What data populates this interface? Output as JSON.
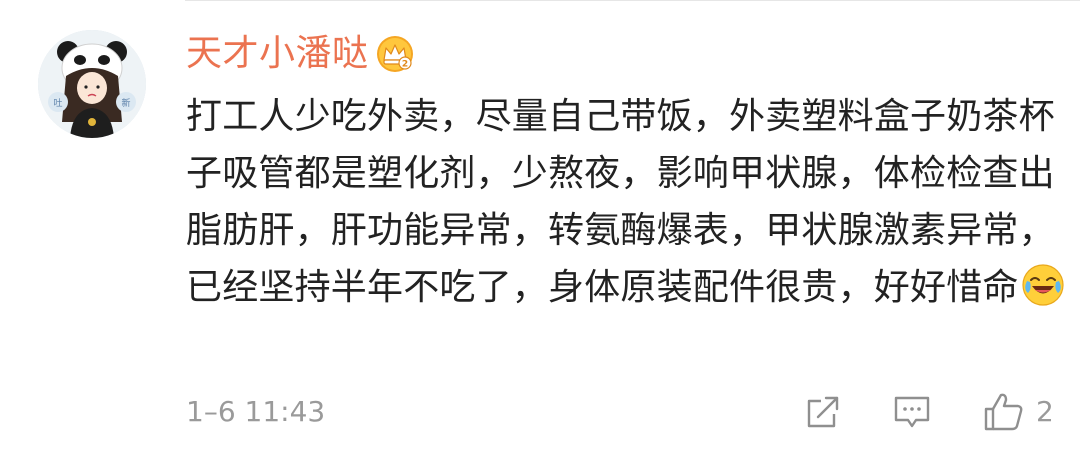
{
  "comment": {
    "username": "天才小潘哒",
    "vip_badge_icon": "crown-vip-icon",
    "text": "打工人少吃外卖，尽量自己带饭，外卖塑料盒子奶茶杯子吸管都是塑化剂，少熬夜，影响甲状腺，体检检查出脂肪肝，肝功能异常，转氨酶爆表，甲状腺激素异常，已经坚持半年不吃了，身体原装配件很贵，好好惜命",
    "emoji": "laugh-cry-emoji",
    "timestamp": "1–6 11:43",
    "like_count": "2"
  },
  "colors": {
    "username": "#eb7350",
    "text": "#222222",
    "meta": "#9a9a9a",
    "badge": "#f5a623"
  },
  "actions": {
    "share_icon": "share-icon",
    "reply_icon": "comment-icon",
    "like_icon": "thumbs-up-icon"
  }
}
